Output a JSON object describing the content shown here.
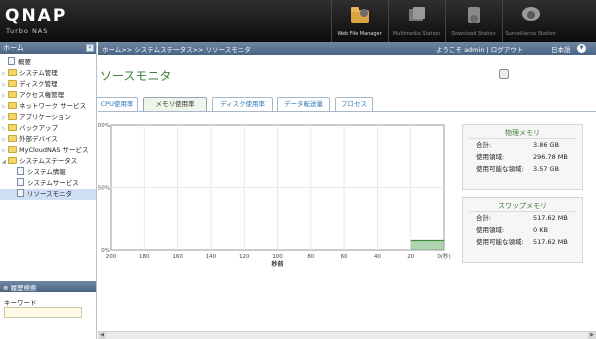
{
  "header": {
    "logo": "QNAP",
    "logo_sub": "Turbo NAS",
    "apps": [
      {
        "label": "Web File Manager",
        "icon": "web-file-manager-icon",
        "active": true
      },
      {
        "label": "Multimedia Station",
        "icon": "multimedia-station-icon",
        "active": false
      },
      {
        "label": "Download Station",
        "icon": "download-station-icon",
        "active": false
      },
      {
        "label": "Surveillance Station",
        "icon": "surveillance-station-icon",
        "active": false
      }
    ]
  },
  "left": {
    "title": "ホーム",
    "tree": [
      {
        "label": "概要",
        "type": "doc",
        "level": 0
      },
      {
        "label": "システム管理",
        "type": "folder",
        "level": 0
      },
      {
        "label": "ディスク管理",
        "type": "folder",
        "level": 0
      },
      {
        "label": "アクセス権管理",
        "type": "folder",
        "level": 0
      },
      {
        "label": "ネットワーク サービス",
        "type": "folder",
        "level": 0
      },
      {
        "label": "アプリケーション",
        "type": "folder",
        "level": 0
      },
      {
        "label": "バックアップ",
        "type": "folder",
        "level": 0
      },
      {
        "label": "外部デバイス",
        "type": "folder",
        "level": 0
      },
      {
        "label": "MyCloudNAS サービス",
        "type": "folder",
        "level": 0
      },
      {
        "label": "システムステータス",
        "type": "folder",
        "level": 0,
        "open": true
      },
      {
        "label": "システム情報",
        "type": "doc",
        "level": 1
      },
      {
        "label": "システムサービス",
        "type": "doc",
        "level": 1
      },
      {
        "label": "リソースモニタ",
        "type": "doc",
        "level": 1,
        "selected": true
      }
    ],
    "search_title": "履歴検索",
    "keyword_label": "キーワード"
  },
  "crumbbar": {
    "breadcrumb": "ホーム>> システムステータス>> リソースモニタ",
    "welcome": "ようこそ admin | ログアウト",
    "language": "日本語"
  },
  "main": {
    "title": "ソースモニタ",
    "tabs": [
      "CPU使用率",
      "メモリ使用率",
      "ディスク使用率",
      "データ転送量",
      "プロセス"
    ],
    "active_tab": 1
  },
  "chart_data": {
    "type": "area",
    "x": [
      200,
      180,
      160,
      140,
      120,
      100,
      80,
      60,
      40,
      20,
      0
    ],
    "x_tick_labels": [
      "200",
      "180",
      "160",
      "140",
      "120",
      "100",
      "80",
      "60",
      "40",
      "20",
      "0(秒)"
    ],
    "xlabel": "秒前",
    "y_tick_labels": [
      "100%",
      "50%",
      "0%"
    ],
    "ylim": [
      0,
      100
    ],
    "series": [
      {
        "values": [
          null,
          null,
          null,
          null,
          null,
          null,
          null,
          null,
          null,
          7.6,
          7.6
        ],
        "color": "#6fb06f"
      }
    ],
    "grid": true
  },
  "physical_memory": {
    "title": "物理メモリ",
    "rows": [
      {
        "label": "合計:",
        "value": "3.86 GB"
      },
      {
        "label": "使用領域:",
        "value": "296.78 MB"
      },
      {
        "label": "使用可能な領域:",
        "value": "3.57 GB"
      }
    ]
  },
  "swap_memory": {
    "title": "スワップメモリ",
    "rows": [
      {
        "label": "合計:",
        "value": "517.62 MB"
      },
      {
        "label": "使用領域:",
        "value": "0 KB"
      },
      {
        "label": "使用可能な領域:",
        "value": "517.62 MB"
      }
    ]
  }
}
